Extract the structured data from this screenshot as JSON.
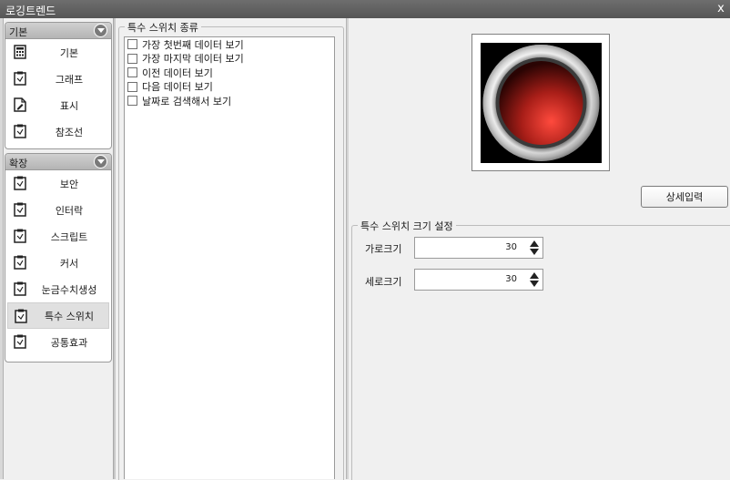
{
  "window": {
    "title": "로깅트렌드",
    "close": "x"
  },
  "sidebar": {
    "groups": [
      {
        "header": "기본",
        "items": [
          {
            "label": "기본",
            "icon": "calculator-icon"
          },
          {
            "label": "그래프",
            "icon": "clipboard-icon"
          },
          {
            "label": "표시",
            "icon": "document-edit-icon"
          },
          {
            "label": "참조선",
            "icon": "clipboard-icon"
          }
        ]
      },
      {
        "header": "확장",
        "items": [
          {
            "label": "보안",
            "icon": "clipboard-icon"
          },
          {
            "label": "인터락",
            "icon": "clipboard-icon"
          },
          {
            "label": "스크립트",
            "icon": "clipboard-icon"
          },
          {
            "label": "커서",
            "icon": "clipboard-icon"
          },
          {
            "label": "눈금수치생성",
            "icon": "clipboard-icon"
          },
          {
            "label": "특수 스위치",
            "icon": "clipboard-icon",
            "selected": true
          },
          {
            "label": "공통효과",
            "icon": "clipboard-icon"
          }
        ]
      }
    ]
  },
  "switch_types": {
    "legend": "특수 스위치 종류",
    "options": [
      {
        "label": "가장 첫번째 데이터 보기",
        "checked": false
      },
      {
        "label": "가장 마지막 데이터 보기",
        "checked": false
      },
      {
        "label": "이전 데이터 보기",
        "checked": false
      },
      {
        "label": "다음 데이터 보기",
        "checked": false
      },
      {
        "label": "날짜로 검색해서 보기",
        "checked": false
      }
    ]
  },
  "preview": {
    "button_color": "#c0302a"
  },
  "detail_button": "상세입력",
  "size": {
    "legend": "특수 스위치 크기 설정",
    "width_label": "가로크기",
    "width_value": "30",
    "height_label": "세로크기",
    "height_value": "30"
  }
}
